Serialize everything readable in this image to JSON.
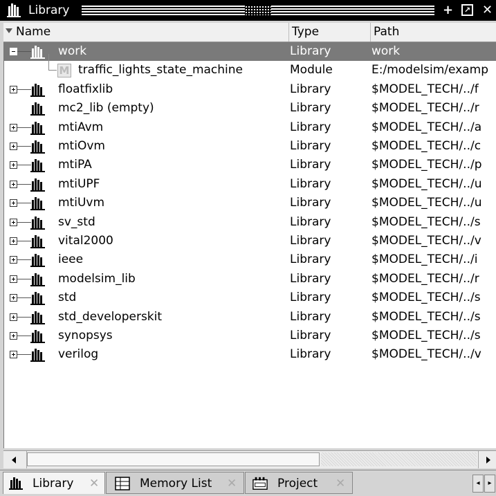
{
  "window": {
    "title": "Library",
    "title_icon": "library-books-icon",
    "buttons": [
      "add-icon",
      "undock-icon",
      "close-icon"
    ]
  },
  "columns": {
    "name": "Name",
    "type": "Type",
    "path": "Path"
  },
  "rows": [
    {
      "name": "work",
      "type": "Library",
      "path": "work",
      "expander": "minus",
      "icon": "library-icon",
      "selected": true
    },
    {
      "name": "traffic_lights_state_machine",
      "type": "Module",
      "path": "E:/modelsim/examp",
      "expander": "none",
      "icon": "module-icon",
      "child": true
    },
    {
      "name": "floatfixlib",
      "type": "Library",
      "path": "$MODEL_TECH/../f",
      "expander": "plus",
      "icon": "library-icon"
    },
    {
      "name": "mc2_lib  (empty)",
      "type": "Library",
      "path": "$MODEL_TECH/../r",
      "expander": "none",
      "icon": "library-icon"
    },
    {
      "name": "mtiAvm",
      "type": "Library",
      "path": "$MODEL_TECH/../a",
      "expander": "plus",
      "icon": "library-icon"
    },
    {
      "name": "mtiOvm",
      "type": "Library",
      "path": "$MODEL_TECH/../c",
      "expander": "plus",
      "icon": "library-icon"
    },
    {
      "name": "mtiPA",
      "type": "Library",
      "path": "$MODEL_TECH/../p",
      "expander": "plus",
      "icon": "library-icon"
    },
    {
      "name": "mtiUPF",
      "type": "Library",
      "path": "$MODEL_TECH/../u",
      "expander": "plus",
      "icon": "library-icon"
    },
    {
      "name": "mtiUvm",
      "type": "Library",
      "path": "$MODEL_TECH/../u",
      "expander": "plus",
      "icon": "library-icon"
    },
    {
      "name": "sv_std",
      "type": "Library",
      "path": "$MODEL_TECH/../s",
      "expander": "plus",
      "icon": "library-icon"
    },
    {
      "name": "vital2000",
      "type": "Library",
      "path": "$MODEL_TECH/../v",
      "expander": "plus",
      "icon": "library-icon"
    },
    {
      "name": "ieee",
      "type": "Library",
      "path": "$MODEL_TECH/../i",
      "expander": "plus",
      "icon": "library-icon"
    },
    {
      "name": "modelsim_lib",
      "type": "Library",
      "path": "$MODEL_TECH/../r",
      "expander": "plus",
      "icon": "library-icon"
    },
    {
      "name": "std",
      "type": "Library",
      "path": "$MODEL_TECH/../s",
      "expander": "plus",
      "icon": "library-icon"
    },
    {
      "name": "std_developerskit",
      "type": "Library",
      "path": "$MODEL_TECH/../s",
      "expander": "plus",
      "icon": "library-icon"
    },
    {
      "name": "synopsys",
      "type": "Library",
      "path": "$MODEL_TECH/../s",
      "expander": "plus",
      "icon": "library-icon"
    },
    {
      "name": "verilog",
      "type": "Library",
      "path": "$MODEL_TECH/../v",
      "expander": "plus",
      "icon": "library-icon"
    }
  ],
  "tabs": [
    {
      "label": "Library",
      "icon": "library-icon",
      "active": true
    },
    {
      "label": "Memory List",
      "icon": "memory-list-icon",
      "active": false
    },
    {
      "label": "Project",
      "icon": "project-icon",
      "active": false
    }
  ]
}
